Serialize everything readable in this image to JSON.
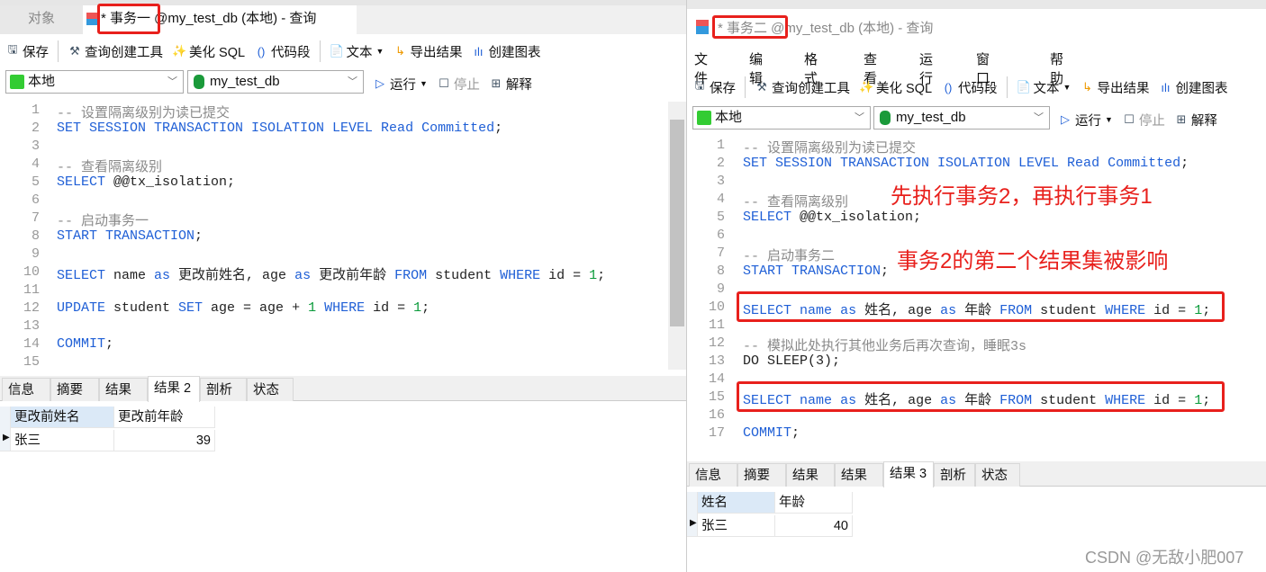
{
  "left": {
    "tabs": {
      "objects": "对象",
      "query": "* 事务一 @my_test_db (本地) - 查询"
    },
    "toolbar": {
      "save": "保存",
      "builder": "查询创建工具",
      "beautify": "美化 SQL",
      "snippet": "代码段",
      "text": "文本",
      "export": "导出结果",
      "chart": "创建图表"
    },
    "connection": "本地",
    "database": "my_test_db",
    "run": "运行",
    "stop": "停止",
    "explain": "解释",
    "code": [
      [
        [
          "-- 设置隔离级别为读已提交",
          "c"
        ]
      ],
      [
        [
          "SET SESSION TRANSACTION ISOLATION LEVEL Read Committed",
          "k"
        ],
        [
          ";",
          "t"
        ]
      ],
      [],
      [
        [
          "-- 查看隔离级别",
          "c"
        ]
      ],
      [
        [
          "SELECT",
          "k"
        ],
        [
          " @@tx_isolation;",
          "t"
        ]
      ],
      [],
      [
        [
          "-- 启动事务一",
          "c"
        ]
      ],
      [
        [
          "START TRANSACTION",
          "k"
        ],
        [
          ";",
          "t"
        ]
      ],
      [],
      [
        [
          "SELECT",
          "k"
        ],
        [
          " name ",
          "t"
        ],
        [
          "as",
          "k"
        ],
        [
          " 更改前姓名, age ",
          "t"
        ],
        [
          "as",
          "k"
        ],
        [
          " 更改前年龄 ",
          "t"
        ],
        [
          "FROM",
          "k"
        ],
        [
          " student ",
          "t"
        ],
        [
          "WHERE",
          "k"
        ],
        [
          " id = ",
          "t"
        ],
        [
          "1",
          "n"
        ],
        [
          ";",
          "t"
        ]
      ],
      [],
      [
        [
          "UPDATE",
          "k"
        ],
        [
          " student ",
          "t"
        ],
        [
          "SET",
          "k"
        ],
        [
          " age = age + ",
          "t"
        ],
        [
          "1",
          "n"
        ],
        [
          " ",
          "t"
        ],
        [
          "WHERE",
          "k"
        ],
        [
          " id = ",
          "t"
        ],
        [
          "1",
          "n"
        ],
        [
          ";",
          "t"
        ]
      ],
      [],
      [
        [
          "COMMIT",
          "k"
        ],
        [
          ";",
          "t"
        ]
      ],
      []
    ],
    "result_tabs": [
      "信息",
      "摘要",
      "结果 1",
      "结果 2",
      "剖析",
      "状态"
    ],
    "active_result_tab": "结果 2",
    "result": {
      "columns": [
        "更改前姓名",
        "更改前年龄"
      ],
      "rows": [
        [
          "张三",
          "39"
        ]
      ]
    }
  },
  "right": {
    "title": "* 事务二 @my_test_db (本地) - 查询",
    "menu": [
      "文件",
      "编辑",
      "格式",
      "查看",
      "运行",
      "窗口",
      "帮助"
    ],
    "toolbar": {
      "save": "保存",
      "builder": "查询创建工具",
      "beautify": "美化 SQL",
      "snippet": "代码段",
      "text": "文本",
      "export": "导出结果",
      "chart": "创建图表"
    },
    "connection": "本地",
    "database": "my_test_db",
    "run": "运行",
    "stop": "停止",
    "explain": "解释",
    "code": [
      [
        [
          "-- 设置隔离级别为读已提交",
          "c"
        ]
      ],
      [
        [
          "SET SESSION TRANSACTION ISOLATION LEVEL Read Committed",
          "k"
        ],
        [
          ";",
          "t"
        ]
      ],
      [],
      [
        [
          "-- 查看隔离级别",
          "c"
        ]
      ],
      [
        [
          "SELECT",
          "k"
        ],
        [
          " @@tx_isolation;",
          "t"
        ]
      ],
      [],
      [
        [
          "-- 启动事务二",
          "c"
        ]
      ],
      [
        [
          "START TRANSACTION",
          "k"
        ],
        [
          ";",
          "t"
        ]
      ],
      [],
      [
        [
          "SELECT",
          "k"
        ],
        [
          " ",
          "t"
        ],
        [
          "name",
          "k"
        ],
        [
          " ",
          "t"
        ],
        [
          "as",
          "k"
        ],
        [
          " 姓名, age ",
          "t"
        ],
        [
          "as",
          "k"
        ],
        [
          " 年龄 ",
          "t"
        ],
        [
          "FROM",
          "k"
        ],
        [
          " student ",
          "t"
        ],
        [
          "WHERE",
          "k"
        ],
        [
          " id = ",
          "t"
        ],
        [
          "1",
          "n"
        ],
        [
          ";",
          "t"
        ]
      ],
      [],
      [
        [
          "-- 模拟此处执行其他业务后再次查询，睡眠3s",
          "c"
        ]
      ],
      [
        [
          "DO SLEEP(3);",
          "t"
        ]
      ],
      [],
      [
        [
          "SELECT",
          "k"
        ],
        [
          " ",
          "t"
        ],
        [
          "name",
          "k"
        ],
        [
          " ",
          "t"
        ],
        [
          "as",
          "k"
        ],
        [
          " 姓名, age ",
          "t"
        ],
        [
          "as",
          "k"
        ],
        [
          " 年龄 ",
          "t"
        ],
        [
          "FROM",
          "k"
        ],
        [
          " student ",
          "t"
        ],
        [
          "WHERE",
          "k"
        ],
        [
          " id = ",
          "t"
        ],
        [
          "1",
          "n"
        ],
        [
          ";",
          "t"
        ]
      ],
      [],
      [
        [
          "COMMIT",
          "k"
        ],
        [
          ";",
          "t"
        ]
      ]
    ],
    "result_tabs": [
      "信息",
      "摘要",
      "结果 1",
      "结果 2",
      "结果 3",
      "剖析",
      "状态"
    ],
    "active_result_tab": "结果 3",
    "result": {
      "columns": [
        "姓名",
        "年龄"
      ],
      "rows": [
        [
          "张三",
          "40"
        ]
      ]
    },
    "annotations": [
      "先执行事务2，再执行事务1",
      "事务2的第二个结果集被影响"
    ]
  },
  "watermark": "CSDN @无敌小肥007",
  "colors": {
    "highlight": "#e8201c",
    "keyword": "#1f5fd6",
    "number": "#0a9a3a",
    "comment": "#8a8a8a"
  }
}
